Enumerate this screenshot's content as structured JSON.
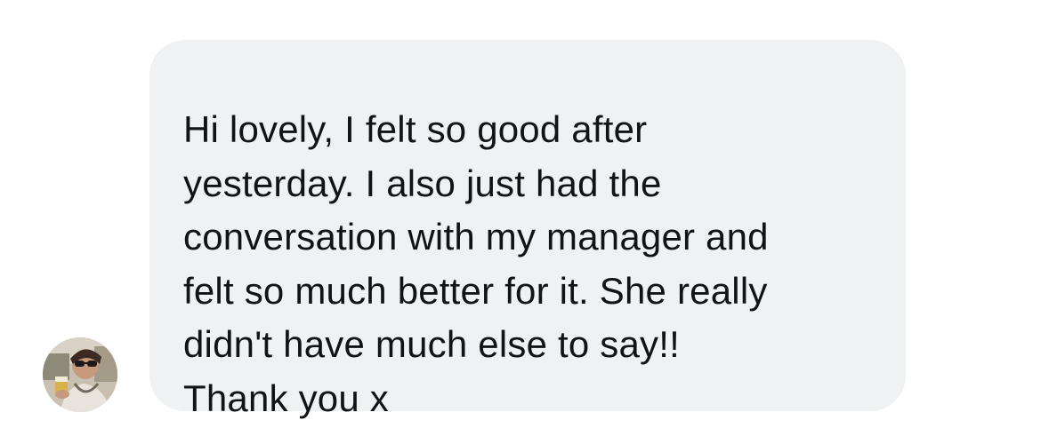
{
  "conversation": {
    "message": {
      "lines": [
        "Hi lovely, I felt so good after",
        "yesterday. I also just had the",
        "conversation with my manager and",
        "felt so much better for it. She really",
        "didn't have much else to say!!",
        "Thank you x"
      ],
      "bubble_color": "#f0f1f3",
      "text_color": "#121316"
    },
    "sender": {
      "avatar_icon": "profile-photo-icon"
    }
  }
}
